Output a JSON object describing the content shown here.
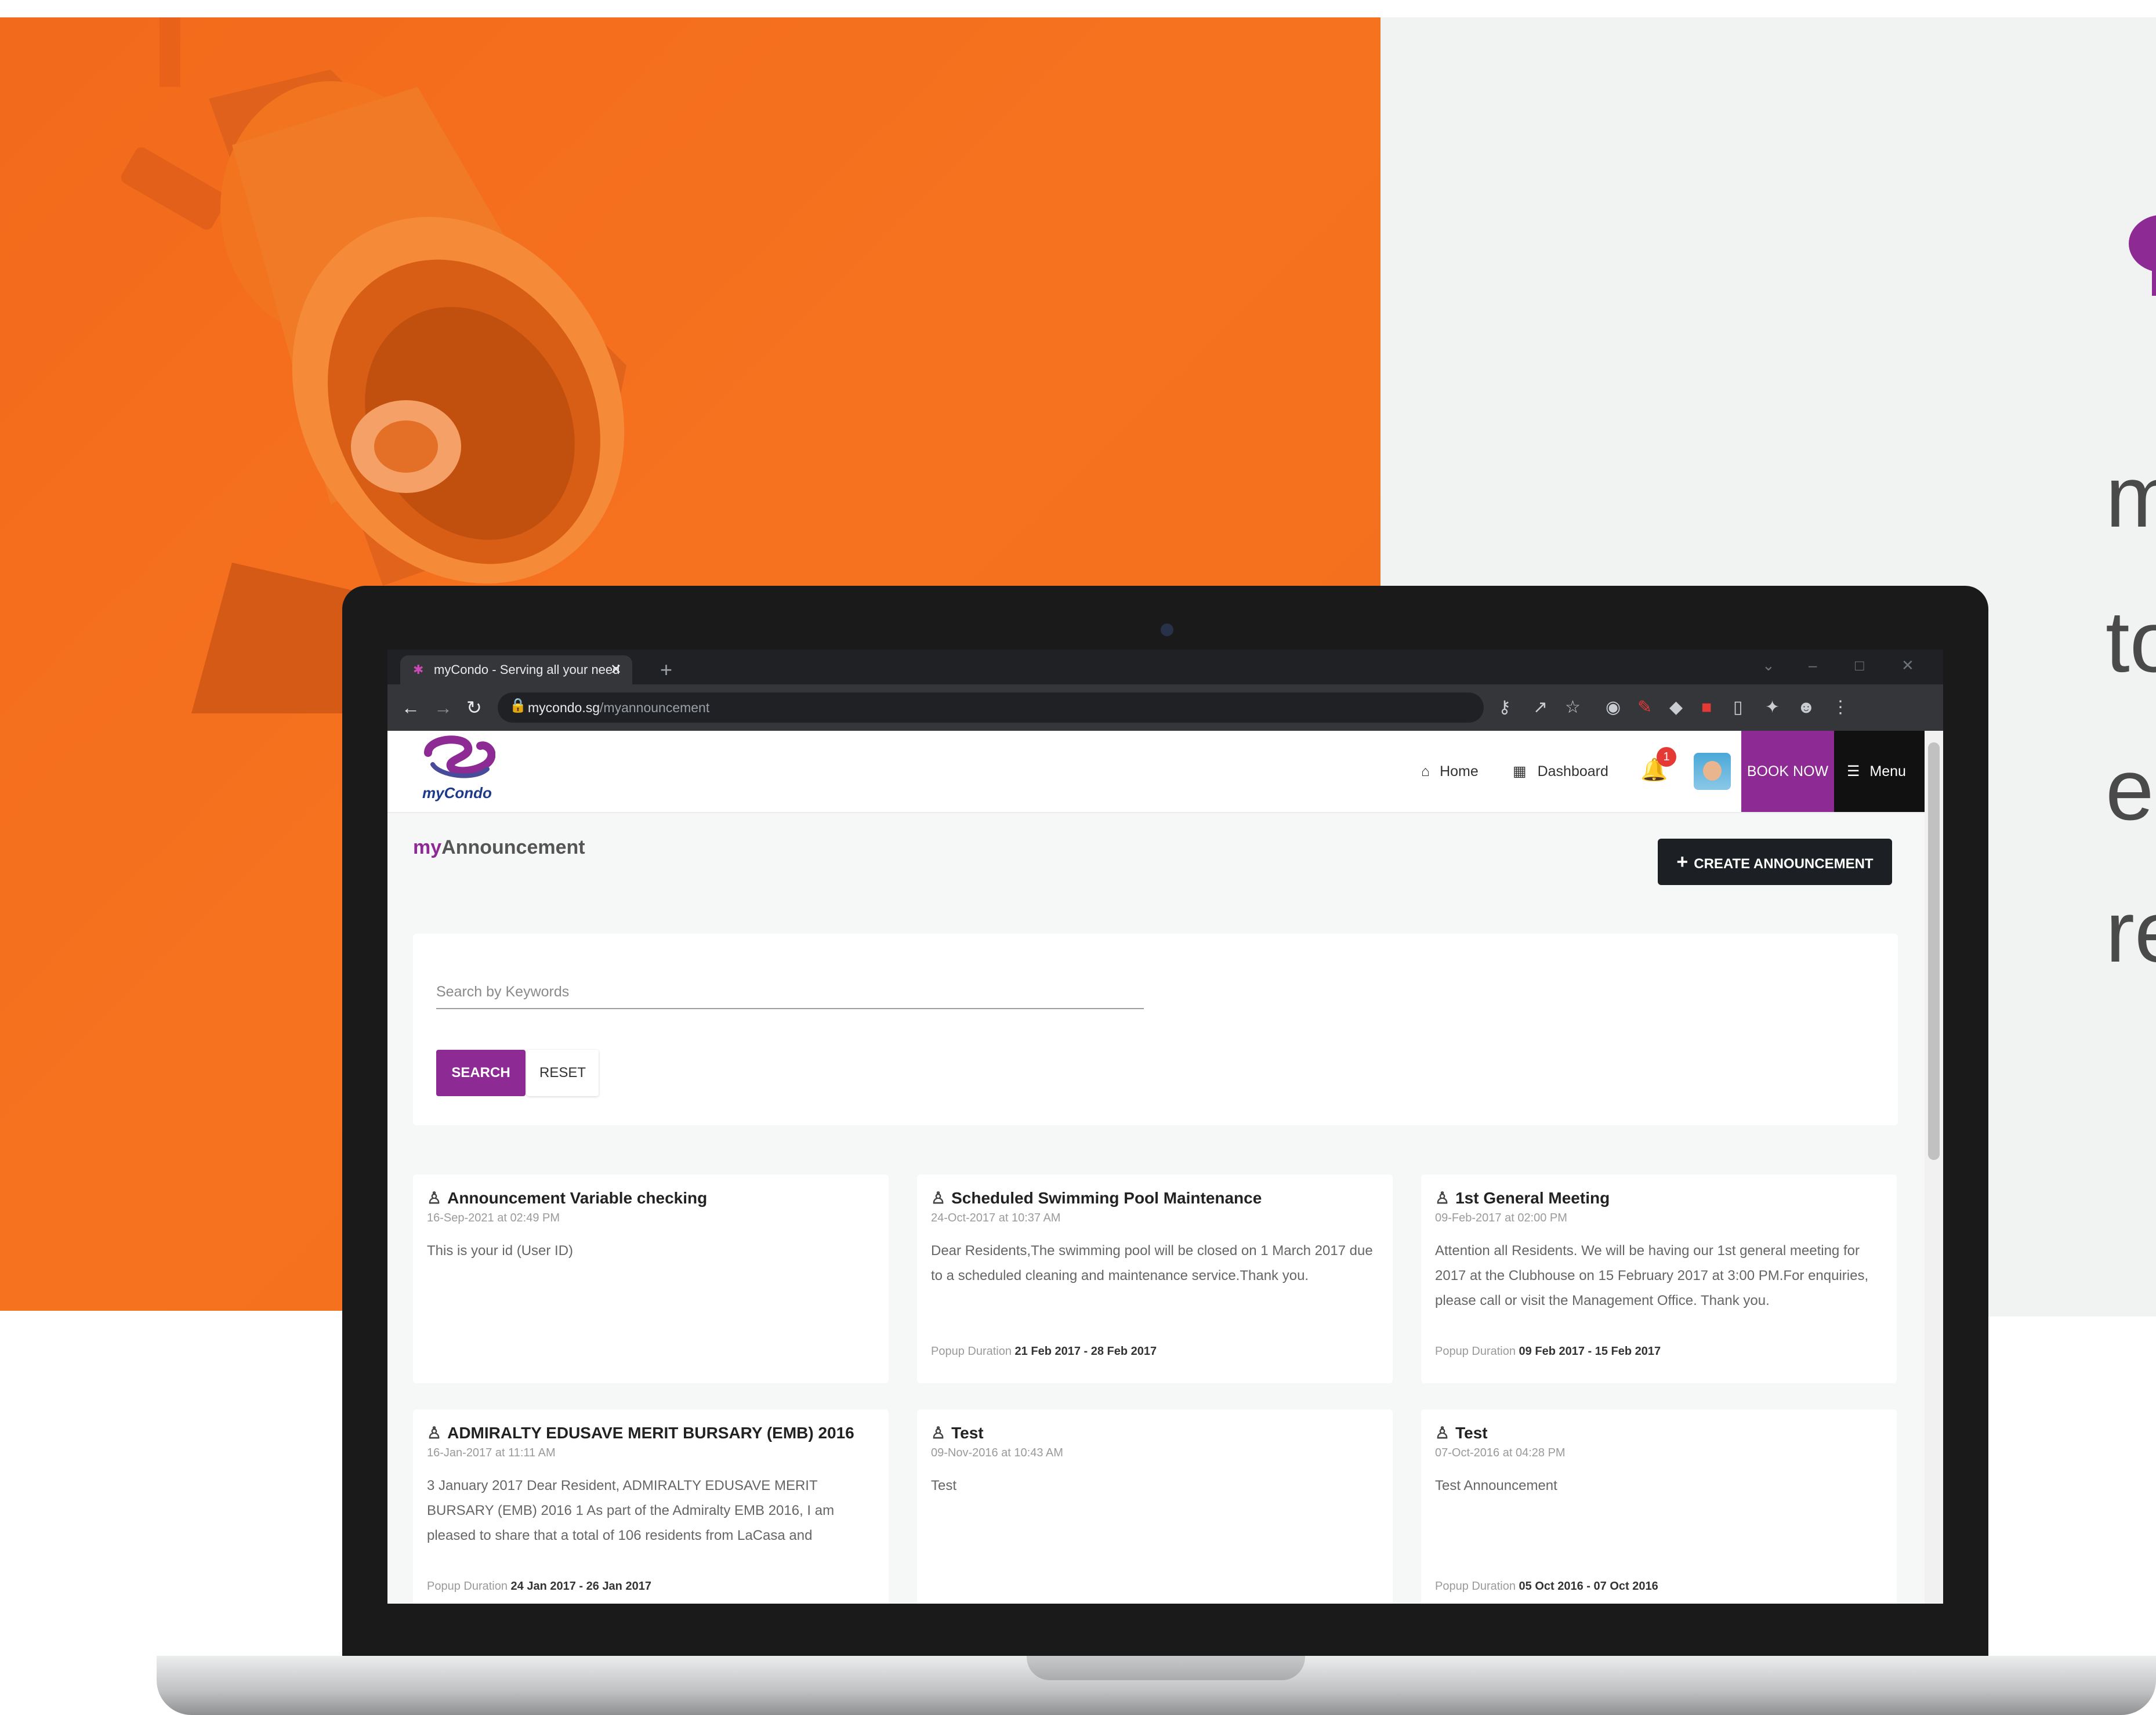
{
  "side_text": [
    "m",
    "to",
    "e",
    "re"
  ],
  "browser": {
    "tab_title": "myCondo - Serving all your need",
    "url_domain": "mycondo.sg",
    "url_path": "/myannouncement"
  },
  "header": {
    "logo_text": "myCondo",
    "nav": [
      {
        "label": "Home",
        "icon": "home-icon"
      },
      {
        "label": "Dashboard",
        "icon": "dashboard-icon"
      }
    ],
    "notification_count": "1",
    "book_now": "BOOK NOW",
    "menu": "Menu"
  },
  "page": {
    "title_prefix": "my",
    "title_main": "Announcement",
    "create_label": "CREATE ANNOUNCEMENT"
  },
  "search": {
    "placeholder": "Search by Keywords",
    "search_label": "SEARCH",
    "reset_label": "RESET"
  },
  "announcements": [
    {
      "title": "Announcement Variable checking",
      "date": "16-Sep-2021 at 02:49 PM",
      "body": "This is your id (User ID)",
      "popup_label": "",
      "popup_range": ""
    },
    {
      "title": "Scheduled Swimming Pool Maintenance",
      "date": "24-Oct-2017 at 10:37 AM",
      "body": "Dear Residents,The swimming pool will be closed on 1 March 2017 due to a scheduled cleaning and maintenance service.Thank you.",
      "popup_label": "Popup Duration",
      "popup_range": "21 Feb 2017 - 28 Feb 2017"
    },
    {
      "title": "1st General Meeting",
      "date": "09-Feb-2017 at 02:00 PM",
      "body": "Attention all Residents. We will be having our 1st general meeting for 2017 at the Clubhouse on 15 February 2017 at 3:00 PM.For enquiries, please call or visit the Management Office.  Thank you.",
      "popup_label": "Popup Duration",
      "popup_range": "09 Feb 2017 - 15 Feb 2017"
    },
    {
      "title": "ADMIRALTY EDUSAVE MERIT BURSARY (EMB) 2016",
      "date": "16-Jan-2017 at 11:11 AM",
      "body": "3 January 2017   Dear Resident, ADMIRALTY EDUSAVE MERIT BURSARY (EMB) 2016 1    As part of the Admiralty EMB 2016, I am pleased to share that a total of 106 residents from LaCasa and",
      "popup_label": "Popup Duration",
      "popup_range": "24 Jan 2017 - 26 Jan 2017"
    },
    {
      "title": "Test",
      "date": "09-Nov-2016 at 10:43 AM",
      "body": "Test",
      "popup_label": "",
      "popup_range": ""
    },
    {
      "title": "Test",
      "date": "07-Oct-2016 at 04:28 PM",
      "body": "Test Announcement",
      "popup_label": "Popup Duration",
      "popup_range": "05 Oct 2016 - 07 Oct 2016"
    }
  ],
  "colors": {
    "accent": "#8e2a94",
    "orange_bg": "#f46f1c",
    "dark": "#1c1f23"
  }
}
